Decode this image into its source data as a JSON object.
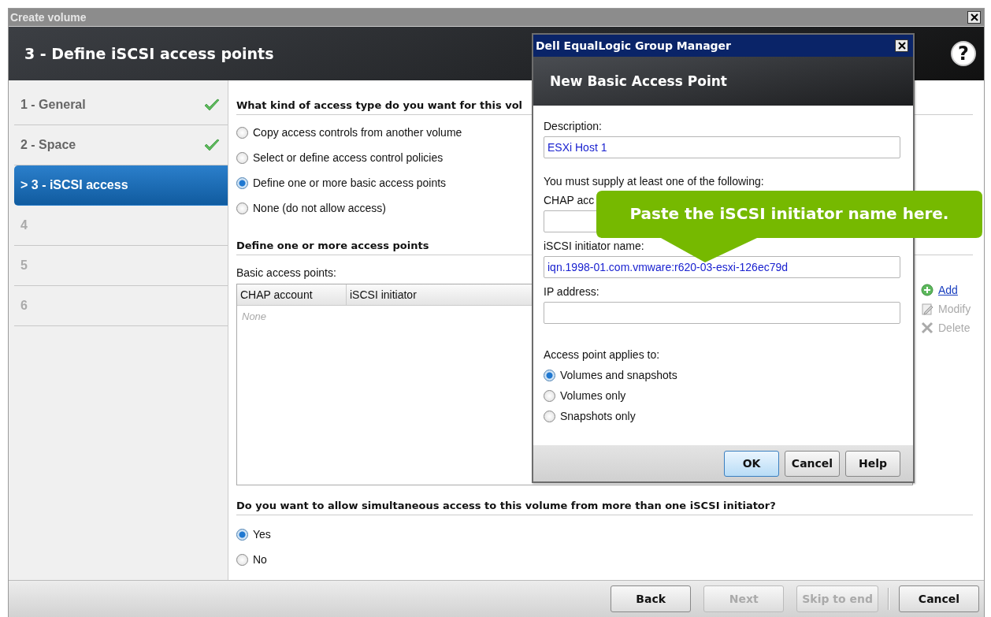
{
  "window": {
    "title": "Create volume"
  },
  "header": {
    "title": "3 - Define iSCSI access points",
    "help": "?"
  },
  "steps": [
    {
      "label": "1 - General",
      "done": true,
      "selected": false,
      "disabled": false
    },
    {
      "label": "2 - Space",
      "done": true,
      "selected": false,
      "disabled": false
    },
    {
      "label": "> 3 - iSCSI access",
      "done": false,
      "selected": true,
      "disabled": false
    },
    {
      "label": "4",
      "done": false,
      "selected": false,
      "disabled": true
    },
    {
      "label": "5",
      "done": false,
      "selected": false,
      "disabled": true
    },
    {
      "label": "6",
      "done": false,
      "selected": false,
      "disabled": true
    }
  ],
  "access_type": {
    "heading": "What kind of access type do you want for this vol",
    "options": [
      {
        "label": "Copy access controls from another volume",
        "selected": false
      },
      {
        "label": "Select or define access control policies",
        "selected": false
      },
      {
        "label": "Define one or more basic access points",
        "selected": true
      },
      {
        "label": "None (do not allow access)",
        "selected": false
      }
    ]
  },
  "access_points": {
    "heading": "Define one or more access points",
    "label": "Basic access points:",
    "table": {
      "columns": [
        "CHAP account",
        "iSCSI initiator"
      ],
      "empty_text": "None"
    },
    "actions": [
      {
        "label": "Add",
        "kind": "add",
        "disabled": false
      },
      {
        "label": "Modify",
        "kind": "modify",
        "disabled": true
      },
      {
        "label": "Delete",
        "kind": "delete",
        "disabled": true
      }
    ]
  },
  "simultaneous": {
    "heading": "Do you want to allow simultaneous access to this volume from more than one iSCSI initiator?",
    "options": [
      {
        "label": "Yes",
        "selected": true
      },
      {
        "label": "No",
        "selected": false
      }
    ]
  },
  "footer": {
    "nav_buttons": [
      {
        "label": "Back",
        "disabled": false
      },
      {
        "label": "Next",
        "disabled": true
      },
      {
        "label": "Skip to end",
        "disabled": true
      }
    ],
    "cancel_button": {
      "label": "Cancel",
      "disabled": false
    }
  },
  "dialog": {
    "title": "Dell EqualLogic Group Manager",
    "header": "New Basic Access Point",
    "description": {
      "label": "Description:",
      "value": "ESXi Host 1"
    },
    "note": "You must supply at least one of the following:",
    "fields": [
      {
        "label": "CHAP acc"
      },
      {
        "label": "iSCSI initiator name:",
        "value": "iqn.1998-01.com.vmware:r620-03-esxi-126ec79d"
      },
      {
        "label": "IP address:"
      }
    ],
    "applies": {
      "label": "Access point applies to:",
      "options": [
        {
          "label": "Volumes and snapshots",
          "selected": true
        },
        {
          "label": "Volumes only",
          "selected": false
        },
        {
          "label": "Snapshots only",
          "selected": false
        }
      ]
    },
    "buttons": [
      {
        "label": "OK",
        "default": true
      },
      {
        "label": "Cancel",
        "default": false
      },
      {
        "label": "Help",
        "default": false
      }
    ]
  },
  "callout": {
    "text": "Paste the iSCSI initiator name here."
  }
}
